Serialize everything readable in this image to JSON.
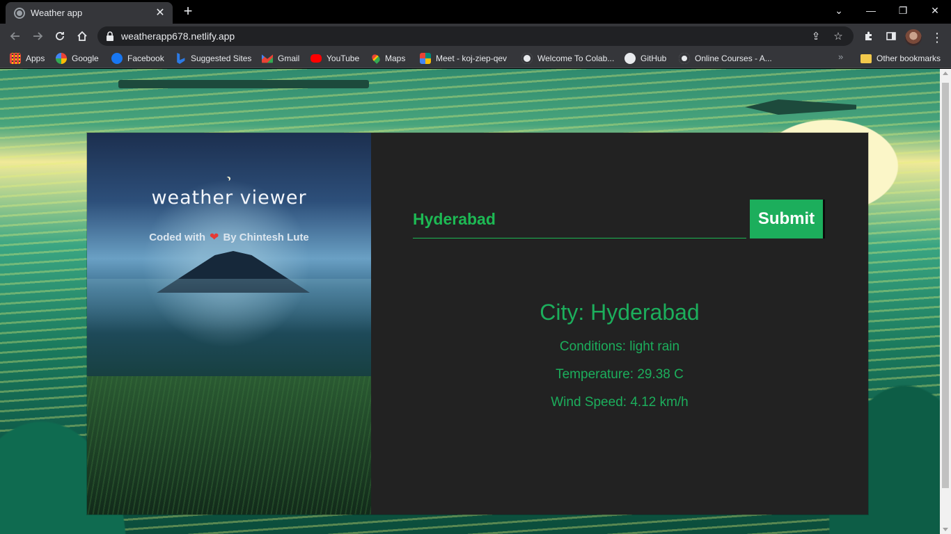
{
  "browser": {
    "tab": {
      "title": "Weather app",
      "close_icon": "close-icon"
    },
    "new_tab_icon": "plus-icon",
    "window_controls": [
      "chevron-down-icon",
      "minimize-icon",
      "restore-icon",
      "close-icon"
    ],
    "url": "weatherapp678.netlify.app",
    "bookmarks": [
      {
        "label": "Apps",
        "icon": "apps-grid-icon",
        "color": "#e8453c"
      },
      {
        "label": "Google",
        "icon": "google-icon",
        "color": "#ffffff"
      },
      {
        "label": "Facebook",
        "icon": "facebook-icon",
        "color": "#1877f2"
      },
      {
        "label": "Suggested Sites",
        "icon": "bing-icon",
        "color": "#2c7be5"
      },
      {
        "label": "Gmail",
        "icon": "gmail-icon",
        "color": "#ea4335"
      },
      {
        "label": "YouTube",
        "icon": "youtube-icon",
        "color": "#ff0000"
      },
      {
        "label": "Maps",
        "icon": "maps-pin-icon",
        "color": "#34a853"
      },
      {
        "label": "Meet - koj-ziep-qev",
        "icon": "meet-icon",
        "color": "#00897b"
      },
      {
        "label": "Welcome To Colab...",
        "icon": "globe-icon",
        "color": "#ffffff"
      },
      {
        "label": "GitHub",
        "icon": "github-icon",
        "color": "#ffffff"
      },
      {
        "label": "Online Courses - A...",
        "icon": "courses-icon",
        "color": "#ffffff"
      }
    ],
    "more_bookmarks": "»",
    "other_bookmarks": "Other bookmarks"
  },
  "app": {
    "title": "weather viewer",
    "credit_prefix": "Coded with",
    "credit_suffix": "By Chintesh Lute",
    "heart": "❤",
    "city_input_value": "Hyderabad",
    "submit_label": "Submit",
    "result": {
      "city": "City: Hyderabad",
      "conditions": "Conditions: light rain",
      "temperature": "Temperature: 29.38 C",
      "wind": "Wind Speed: 4.12 km/h"
    },
    "accent_color": "#1cae5c"
  }
}
